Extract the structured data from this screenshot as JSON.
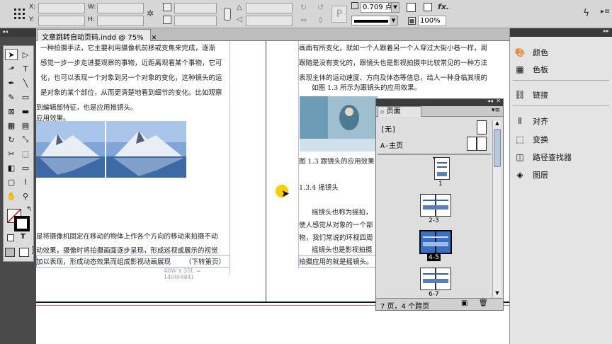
{
  "control": {
    "x_label": "X:",
    "y_label": "Y:",
    "w_label": "W:",
    "h_label": "H:",
    "stroke_weight": "0.709 点",
    "zoom_percent": "100%",
    "fx_label": "fx."
  },
  "document": {
    "tab_title": "文章跳转自动页码.indd @ 75%",
    "tab_close": "✕",
    "left_page_lines": [
      "一种拍摄手法，它主要利用摄像机前移或变焦来完成，逐渐",
      "感觉一步一步走进要观察的事物，近距离观看某个事物，它可",
      "化，也可以表现一个对象到另一个对象的变化，这种镜头的运",
      "是对象的某个部位，从而更清楚地看到细节的变化。比如观察",
      "到编辑部特征，也是应用推镜头。",
      "应用效果。"
    ],
    "left_page_bottom_lines": [
      "是将摄像机固定在移动的物体上作各个方向的移动来拍摄不动",
      "动效果，摄像时将拍摄画面逐步呈现，形成巡视或展示的视觉",
      "加以表现，形成动态效果而组成影视动画展现"
    ],
    "jump_label": "（下转第页）",
    "frame_info": "40W x 35L = 1400(684)",
    "right_page_lines": [
      "画面有所变化，就如一个人跟着另一个人穿过大街小巷一样，周",
      "跟随是没有变化的，跟镜头也是影视拍摄中比较常见的一种方法",
      "表现主体的运动速度、方向及体态等信息，给人一种身临其境的"
    ],
    "fig_ref_line": "如图 1.3 所示为跟镜头的应用效果。",
    "fig_caption": "图 1.3 跟镜头的应用效果",
    "section_heading": "1.3.4 摇镜头",
    "right_page_bottom_lines": [
      "摇镜头也称为摇拍，",
      "使人感觉从对象的一个部",
      "物，我们常说的环视四周",
      "摇镜头也是影视拍摄",
      "拍摄应用的就是摇镜头。"
    ]
  },
  "pages_panel": {
    "title": "页面",
    "none_label": "[无]",
    "master_label": "A-主页",
    "spreads": [
      {
        "label": "1"
      },
      {
        "label": "2-3"
      },
      {
        "label": "4-5"
      },
      {
        "label": "6-7"
      }
    ],
    "status": "7 页，4 个跨页"
  },
  "right_panels": [
    {
      "label": "颜色",
      "icon": "color-icon"
    },
    {
      "label": "色板",
      "icon": "swatches-icon"
    },
    {
      "label": "链接",
      "icon": "links-icon"
    },
    {
      "label": "对齐",
      "icon": "align-icon"
    },
    {
      "label": "变换",
      "icon": "transform-icon"
    },
    {
      "label": "路径查找器",
      "icon": "pathfinder-icon"
    },
    {
      "label": "图层",
      "icon": "layers-icon"
    }
  ],
  "colors": {
    "ui_gray": "#d6d6d6",
    "dark_gray": "#4a4a4a",
    "selection_blue": "#3b6fc4",
    "margin_purple": "#b9a6e0"
  }
}
